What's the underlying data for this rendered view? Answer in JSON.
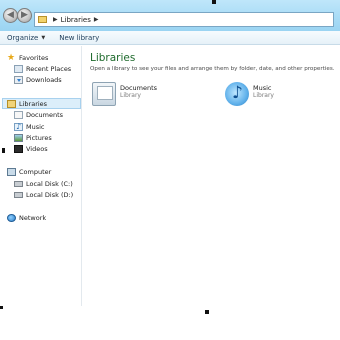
{
  "address": {
    "breadcrumb": [
      "Libraries"
    ]
  },
  "toolbar": {
    "organize_label": "Organize",
    "new_library_label": "New library"
  },
  "navigation": {
    "favorites": "Favorites",
    "recent_places": "Recent Places",
    "downloads": "Downloads",
    "libraries": "Libraries",
    "documents": "Documents",
    "music": "Music",
    "pictures": "Pictures",
    "videos": "Videos",
    "computer": "Computer",
    "local_disk_c": "Local Disk (C:)",
    "local_disk_d": "Local Disk (D:)",
    "network": "Network"
  },
  "content": {
    "title": "Libraries",
    "subtitle": "Open a library to see your files and arrange them by folder, date, and other properties.",
    "libraries": [
      {
        "name": "Documents",
        "type": "Library",
        "icon": "documents-library-icon"
      },
      {
        "name": "Music",
        "type": "Library",
        "icon": "music-library-icon"
      }
    ]
  },
  "colors": {
    "title_green": "#1e6a2c",
    "selected_bg": "#dceefa",
    "titlebar": "#a9dcf6"
  }
}
